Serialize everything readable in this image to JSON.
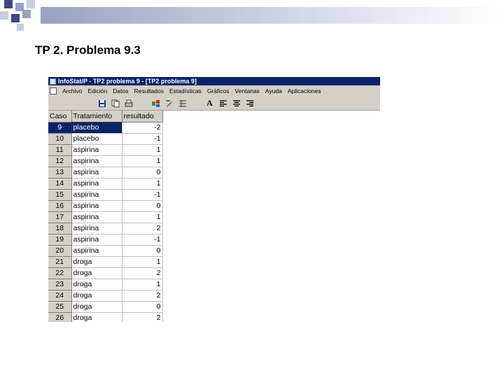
{
  "slide": {
    "title": "TP 2. Problema 9.3"
  },
  "window": {
    "title": "InfoStat/P - TP2 problema 9 - [TP2 problema 9]"
  },
  "menu": [
    "Archivo",
    "Edición",
    "Datos",
    "Resultados",
    "Estadísticas",
    "Gráficos",
    "Ventanas",
    "Ayuda",
    "Aplicaciones"
  ],
  "toolbar": {
    "buttons": [
      "save-icon",
      "copy-icon",
      "print-icon",
      "data-icon",
      "edit-icon",
      "table-icon",
      "bold-text-icon",
      "align-left-icon",
      "align-center-icon",
      "align-right-icon"
    ]
  },
  "grid": {
    "headers": {
      "case": "Caso",
      "tratamiento": "Tratamiento",
      "resultado": "resultado"
    },
    "rows": [
      {
        "case": "9",
        "tratamiento": "placebo",
        "resultado": "-2",
        "selected": true
      },
      {
        "case": "10",
        "tratamiento": "placebo",
        "resultado": "-1"
      },
      {
        "case": "11",
        "tratamiento": "aspirina",
        "resultado": "1"
      },
      {
        "case": "12",
        "tratamiento": "aspirina",
        "resultado": "1"
      },
      {
        "case": "13",
        "tratamiento": "aspirina",
        "resultado": "0"
      },
      {
        "case": "14",
        "tratamiento": "aspirina",
        "resultado": "1"
      },
      {
        "case": "15",
        "tratamiento": "aspirina",
        "resultado": "-1"
      },
      {
        "case": "16",
        "tratamiento": "aspirina",
        "resultado": "0"
      },
      {
        "case": "17",
        "tratamiento": "aspirina",
        "resultado": "1"
      },
      {
        "case": "18",
        "tratamiento": "aspirina",
        "resultado": "2"
      },
      {
        "case": "19",
        "tratamiento": "aspirina",
        "resultado": "-1"
      },
      {
        "case": "20",
        "tratamiento": "aspirina",
        "resultado": "0"
      },
      {
        "case": "21",
        "tratamiento": "droga",
        "resultado": "1"
      },
      {
        "case": "22",
        "tratamiento": "droga",
        "resultado": "2"
      },
      {
        "case": "23",
        "tratamiento": "droga",
        "resultado": "1"
      },
      {
        "case": "24",
        "tratamiento": "droga",
        "resultado": "2"
      },
      {
        "case": "25",
        "tratamiento": "droga",
        "resultado": "0"
      },
      {
        "case": "26",
        "tratamiento": "droga",
        "resultado": "2"
      }
    ]
  },
  "colors": {
    "title_bar": "#0a246a",
    "chrome": "#d4d0c8",
    "selection": "#0a246a"
  }
}
